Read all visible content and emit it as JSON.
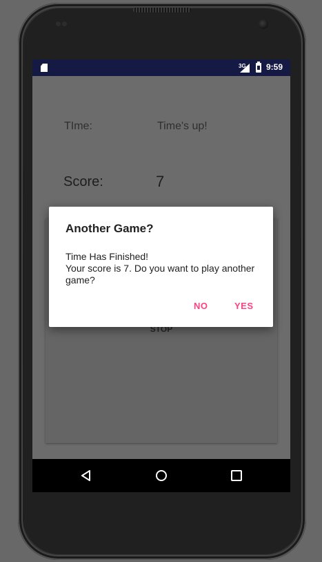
{
  "status_bar": {
    "network_type": "3G",
    "time": "9:59",
    "icons": [
      "sd-card-icon",
      "signal-icon",
      "battery-icon"
    ]
  },
  "app": {
    "time_label": "TIme:",
    "time_value": "Time's up!",
    "score_label": "Score:",
    "score_value": "7",
    "stop_label": "STOP"
  },
  "dialog": {
    "title": "Another Game?",
    "message": "Time Has Finished!\nYour score is 7. Do you want to play another game?",
    "negative_label": "NO",
    "positive_label": "YES",
    "accent_color": "#ff4081"
  },
  "navigation": {
    "icons": [
      "back-icon",
      "home-icon",
      "recents-icon"
    ]
  },
  "colors": {
    "status_bar": "#151a45",
    "dim_background": "#6c6c6c",
    "nav_bar": "#000000"
  }
}
